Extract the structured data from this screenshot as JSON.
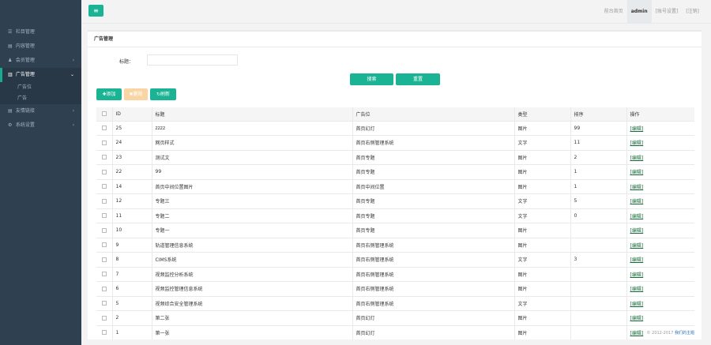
{
  "sidebar": {
    "items": [
      {
        "icon": "☰",
        "label": "栏目管理",
        "chevron": ""
      },
      {
        "icon": "▤",
        "label": "内容管理",
        "chevron": ""
      },
      {
        "icon": "♟",
        "label": "会员管理",
        "chevron": "‹"
      },
      {
        "icon": "▥",
        "label": "广告管理",
        "chevron": "⌄"
      },
      {
        "icon": "▤",
        "label": "友情链接",
        "chevron": "‹"
      },
      {
        "icon": "⚙",
        "label": "系统设置",
        "chevron": "‹"
      }
    ],
    "subitems": [
      "广告位",
      "广告"
    ]
  },
  "topbar": {
    "menu_icon": "≡",
    "links": [
      "前台首页",
      "admin",
      "[账号设置]",
      "[注销]"
    ]
  },
  "panel": {
    "title": "广告管理",
    "search_label": "标题：",
    "search_value": ""
  },
  "buttons": {
    "search": "搜索",
    "reset": "重置",
    "add": "✚添加",
    "delete": "✖删除",
    "refresh": "↻刷新"
  },
  "table": {
    "headers": [
      "",
      "ID",
      "标题",
      "广告位",
      "类型",
      "排序",
      "操作"
    ],
    "rows": [
      {
        "id": "25",
        "title": "zzzz",
        "position": "首页幻灯",
        "type": "图片",
        "sort": "99",
        "action": "[编辑]"
      },
      {
        "id": "24",
        "title": "网页样式",
        "position": "首页右侧管理系统",
        "type": "文字",
        "sort": "11",
        "action": "[编辑]"
      },
      {
        "id": "23",
        "title": "测试文",
        "position": "首页专题",
        "type": "图片",
        "sort": "2",
        "action": "[编辑]"
      },
      {
        "id": "22",
        "title": "99",
        "position": "首页专题",
        "type": "图片",
        "sort": "1",
        "action": "[编辑]"
      },
      {
        "id": "14",
        "title": "首页中间位置图片",
        "position": "首页中间位置",
        "type": "图片",
        "sort": "1",
        "action": "[编辑]"
      },
      {
        "id": "12",
        "title": "专题三",
        "position": "首页专题",
        "type": "文字",
        "sort": "5",
        "action": "[编辑]"
      },
      {
        "id": "11",
        "title": "专题二",
        "position": "首页专题",
        "type": "文字",
        "sort": "0",
        "action": "[编辑]"
      },
      {
        "id": "10",
        "title": "专题一",
        "position": "首页专题",
        "type": "图片",
        "sort": "",
        "action": "[编辑]"
      },
      {
        "id": "9",
        "title": "轨道管理信息系统",
        "position": "首页右侧管理系统",
        "type": "图片",
        "sort": "",
        "action": "[编辑]"
      },
      {
        "id": "8",
        "title": "CIMS系统",
        "position": "首页右侧管理系统",
        "type": "文字",
        "sort": "3",
        "action": "[编辑]"
      },
      {
        "id": "7",
        "title": "视频监控分析系统",
        "position": "首页右侧管理系统",
        "type": "图片",
        "sort": "",
        "action": "[编辑]"
      },
      {
        "id": "6",
        "title": "视频监控管理信息系统",
        "position": "首页右侧管理系统",
        "type": "图片",
        "sort": "",
        "action": "[编辑]"
      },
      {
        "id": "5",
        "title": "视频综合安全管理系统",
        "position": "首页右侧管理系统",
        "type": "文字",
        "sort": "",
        "action": "[编辑]"
      },
      {
        "id": "2",
        "title": "第二张",
        "position": "首页幻灯",
        "type": "图片",
        "sort": "",
        "action": "[编辑]"
      },
      {
        "id": "1",
        "title": "第一张",
        "position": "首页幻灯",
        "type": "图片",
        "sort": "",
        "action": "[编辑]"
      }
    ]
  },
  "footer": {
    "copyright": "© 2012-2017",
    "link": "我们的主题"
  },
  "colors": {
    "sidebar_bg": "#2f4050",
    "accent": "#1ab394",
    "delete_btn": "#f8d5a3"
  }
}
